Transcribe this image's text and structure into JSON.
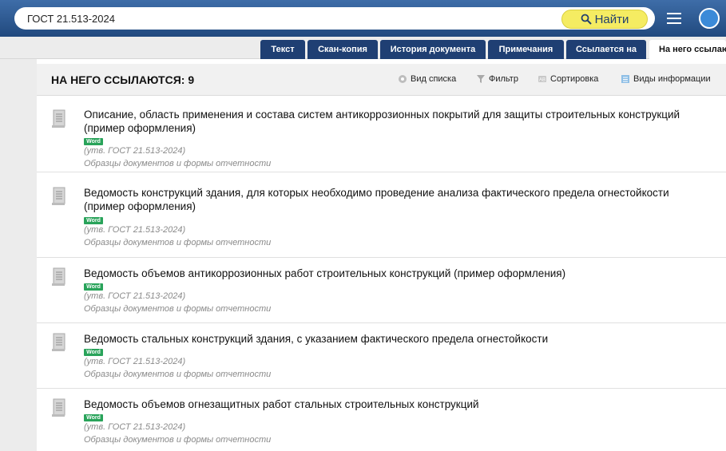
{
  "search": {
    "value": "ГОСТ 21.513-2024",
    "find_label": "Найти"
  },
  "tabs": [
    {
      "label": "Текст",
      "active": false
    },
    {
      "label": "Скан-копия",
      "active": false
    },
    {
      "label": "История документа",
      "active": false
    },
    {
      "label": "Примечания",
      "active": false
    },
    {
      "label": "Ссылается на",
      "active": false
    },
    {
      "label": "На него ссылаются",
      "active": true
    }
  ],
  "panel": {
    "title": "НА НЕГО ССЫЛАЮТСЯ: 9",
    "toolbar": {
      "list_view": "Вид списка",
      "filter": "Фильтр",
      "sort": "Сортировка",
      "info_types": "Виды информации"
    }
  },
  "documents": [
    {
      "title": "Описание, область применения и состава систем антикоррозионных покрытий для защиты строительных конструкций (пример оформления)",
      "badge": "Word",
      "approved": "(утв. ГОСТ 21.513-2024)",
      "category": "Образцы документов и формы отчетности"
    },
    {
      "title": "Ведомость конструкций здания, для которых необходимо проведение анализа фактического предела огнестойкости (пример оформления)",
      "badge": "Word",
      "approved": "(утв. ГОСТ 21.513-2024)",
      "category": "Образцы документов и формы отчетности"
    },
    {
      "title": "Ведомость объемов антикоррозионных работ строительных конструкций (пример оформления)",
      "badge": "Word",
      "approved": "(утв. ГОСТ 21.513-2024)",
      "category": "Образцы документов и формы отчетности"
    },
    {
      "title": "Ведомость стальных конструкций здания, с указанием фактического предела огнестойкости",
      "badge": "Word",
      "approved": "(утв. ГОСТ 21.513-2024)",
      "category": "Образцы документов и формы отчетности"
    },
    {
      "title": "Ведомость объемов огнезащитных работ стальных строительных конструкций",
      "badge": "Word",
      "approved": "(утв. ГОСТ 21.513-2024)",
      "category": "Образцы документов и формы отчетности"
    }
  ],
  "colors": {
    "header": "#2c5a94",
    "tab": "#1f3f73",
    "find_button": "#f5ec62",
    "badge": "#29a35a"
  },
  "icons": [
    "search-icon",
    "menu-icon",
    "user-icon",
    "list-view-icon",
    "filter-icon",
    "sort-icon",
    "info-types-icon",
    "document-icon"
  ]
}
